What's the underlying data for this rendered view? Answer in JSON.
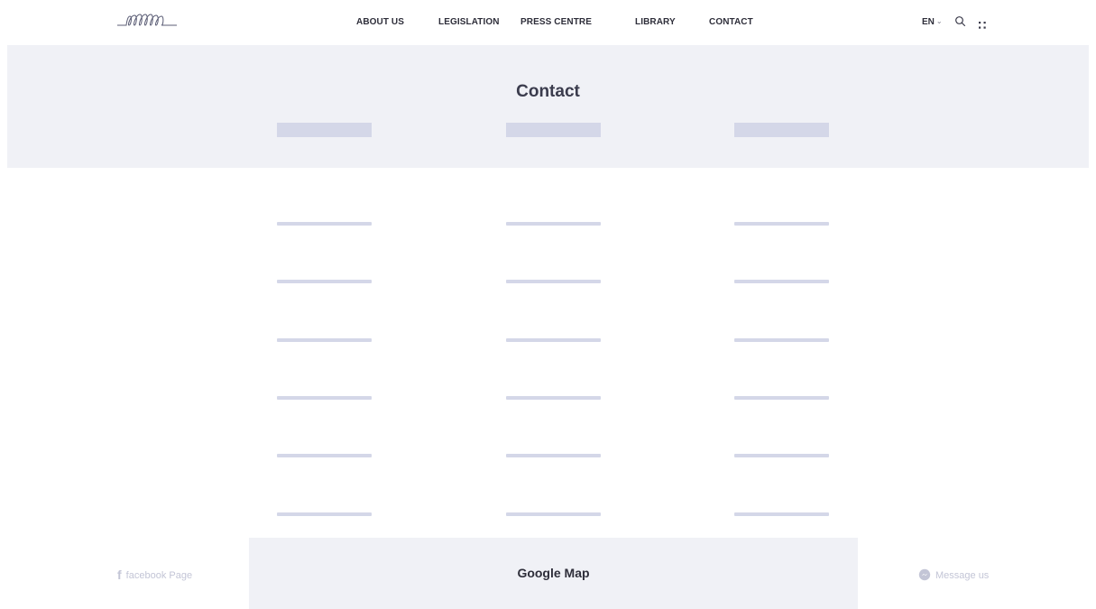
{
  "header": {
    "logo_icon": "spiral-coil-logo",
    "nav": [
      {
        "label": "ABOUT US"
      },
      {
        "label": "LEGISLATION"
      },
      {
        "label": "PRESS CENTRE"
      },
      {
        "label": "LIBRARY"
      },
      {
        "label": "CONTACT"
      }
    ],
    "language": "EN",
    "language_chevron": "⌄",
    "search_icon": "search-icon",
    "menu_icon": "grid-dots-icon"
  },
  "hero": {
    "title": "Contact",
    "background": "#f0f1f6",
    "tab_count": 3
  },
  "content": {
    "placeholder_rows": 6,
    "placeholder_columns": 3,
    "placeholder_color": "#d4d7e8"
  },
  "footer": {
    "facebook_icon": "f",
    "facebook_label": "facebook Page",
    "map_label": "Google Map",
    "message_label": "Message us",
    "muted_color": "#c3c5d6"
  }
}
